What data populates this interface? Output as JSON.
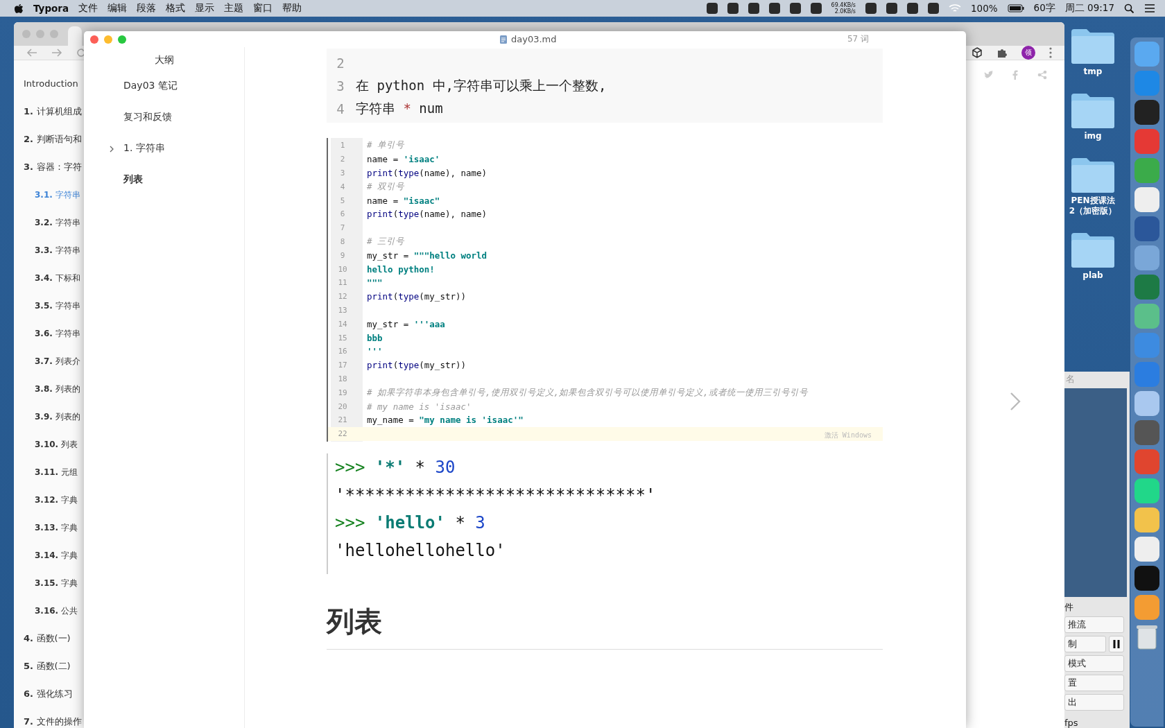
{
  "menubar": {
    "app": "Typora",
    "menus": [
      "文件",
      "编辑",
      "段落",
      "格式",
      "显示",
      "主题",
      "窗口",
      "帮助"
    ],
    "net_up": "69.4KB/s",
    "net_down": "2.0KB/s",
    "battery": "100%",
    "word_count": "60字",
    "clock": "周二 09:17"
  },
  "browser": {
    "avatar": "领",
    "toc": [
      {
        "title": "Introduction",
        "selected": false
      },
      {
        "number": "1.",
        "title": "计算机组成",
        "selected": false
      },
      {
        "number": "2.",
        "title": "判断语句和",
        "selected": false
      },
      {
        "number": "3.",
        "title": "容器：字符",
        "selected": false,
        "children": [
          {
            "number": "3.1.",
            "title": "字符串",
            "selected": true
          },
          {
            "number": "3.2.",
            "title": "字符串",
            "selected": false
          },
          {
            "number": "3.3.",
            "title": "字符串",
            "selected": false
          },
          {
            "number": "3.4.",
            "title": "下标和",
            "selected": false
          },
          {
            "number": "3.5.",
            "title": "字符串",
            "selected": false
          },
          {
            "number": "3.6.",
            "title": "字符串",
            "selected": false
          },
          {
            "number": "3.7.",
            "title": "列表介",
            "selected": false
          },
          {
            "number": "3.8.",
            "title": "列表的",
            "selected": false
          },
          {
            "number": "3.9.",
            "title": "列表的",
            "selected": false
          },
          {
            "number": "3.10.",
            "title": "列表",
            "selected": false
          },
          {
            "number": "3.11.",
            "title": "元组",
            "selected": false
          },
          {
            "number": "3.12.",
            "title": "字典",
            "selected": false
          },
          {
            "number": "3.13.",
            "title": "字典",
            "selected": false
          },
          {
            "number": "3.14.",
            "title": "字典",
            "selected": false
          },
          {
            "number": "3.15.",
            "title": "字典",
            "selected": false
          },
          {
            "number": "3.16.",
            "title": "公共",
            "selected": false
          }
        ]
      },
      {
        "number": "4.",
        "title": "函数(一)",
        "selected": false
      },
      {
        "number": "5.",
        "title": "函数(二)",
        "selected": false
      },
      {
        "number": "6.",
        "title": "强化练习",
        "selected": false
      },
      {
        "number": "7.",
        "title": "文件的操作",
        "selected": false
      }
    ]
  },
  "typora": {
    "file_name": "day03.md",
    "word_count": "57 词",
    "outline": {
      "title": "大纲",
      "items": [
        {
          "label": "Day03 笔记",
          "kind": "normal"
        },
        {
          "label": "复习和反馈",
          "kind": "normal"
        },
        {
          "label": "1. 字符串",
          "kind": "normal",
          "expanded": false
        },
        {
          "label": "列表",
          "kind": "strong"
        }
      ]
    },
    "code_block": [
      {
        "n": "2"
      },
      {
        "n": "3",
        "tokens": [
          {
            "kind": "plain",
            "text": "在 python 中,字符串可以乘上一个整数,"
          }
        ]
      },
      {
        "n": "4",
        "tokens": [
          {
            "kind": "plain",
            "text": "字符串 "
          },
          {
            "kind": "operator",
            "text": "*"
          },
          {
            "kind": "plain",
            "text": " num"
          }
        ]
      }
    ],
    "editor_screenshot": {
      "watermark_text": "激活 Windows",
      "lines": [
        {
          "n": "1",
          "tokens": [
            {
              "kind": "comment",
              "text": "# 单引号"
            }
          ]
        },
        {
          "n": "2",
          "tokens": [
            {
              "kind": "plain",
              "text": "name = "
            },
            {
              "kind": "string",
              "text": "'isaac'"
            }
          ]
        },
        {
          "n": "3",
          "tokens": [
            {
              "kind": "keyword",
              "text": "print"
            },
            {
              "kind": "plain",
              "text": "("
            },
            {
              "kind": "keyword",
              "text": "type"
            },
            {
              "kind": "plain",
              "text": "(name), name)"
            }
          ]
        },
        {
          "n": "4",
          "tokens": [
            {
              "kind": "comment",
              "text": "# 双引号"
            }
          ]
        },
        {
          "n": "5",
          "tokens": [
            {
              "kind": "plain",
              "text": "name = "
            },
            {
              "kind": "string",
              "text": "\"isaac\""
            }
          ]
        },
        {
          "n": "6",
          "tokens": [
            {
              "kind": "keyword",
              "text": "print"
            },
            {
              "kind": "plain",
              "text": "("
            },
            {
              "kind": "keyword",
              "text": "type"
            },
            {
              "kind": "plain",
              "text": "(name), name)"
            }
          ]
        },
        {
          "n": "7"
        },
        {
          "n": "8",
          "tokens": [
            {
              "kind": "comment",
              "text": "# 三引号"
            }
          ]
        },
        {
          "n": "9",
          "tokens": [
            {
              "kind": "plain",
              "text": "my_str = "
            },
            {
              "kind": "string",
              "text": "\"\"\"hello world"
            }
          ]
        },
        {
          "n": "10",
          "tokens": [
            {
              "kind": "string",
              "text": "hello python!"
            }
          ]
        },
        {
          "n": "11",
          "tokens": [
            {
              "kind": "string",
              "text": "\"\"\""
            }
          ]
        },
        {
          "n": "12",
          "tokens": [
            {
              "kind": "keyword",
              "text": "print"
            },
            {
              "kind": "plain",
              "text": "("
            },
            {
              "kind": "keyword",
              "text": "type"
            },
            {
              "kind": "plain",
              "text": "(my_str))"
            }
          ]
        },
        {
          "n": "13"
        },
        {
          "n": "14",
          "tokens": [
            {
              "kind": "plain",
              "text": "my_str = "
            },
            {
              "kind": "string",
              "text": "'''aaa"
            }
          ]
        },
        {
          "n": "15",
          "tokens": [
            {
              "kind": "string",
              "text": "bbb"
            }
          ]
        },
        {
          "n": "16",
          "tokens": [
            {
              "kind": "string",
              "text": "'''"
            }
          ]
        },
        {
          "n": "17",
          "tokens": [
            {
              "kind": "keyword",
              "text": "print"
            },
            {
              "kind": "plain",
              "text": "("
            },
            {
              "kind": "keyword",
              "text": "type"
            },
            {
              "kind": "plain",
              "text": "(my_str))"
            }
          ]
        },
        {
          "n": "18"
        },
        {
          "n": "19",
          "tokens": [
            {
              "kind": "comment",
              "text": "# 如果字符串本身包含单引号,使用双引号定义,如果包含双引号可以使用单引号定义,或者统一使用三引号引号"
            }
          ]
        },
        {
          "n": "20",
          "tokens": [
            {
              "kind": "comment",
              "text": "# my name is 'isaac'"
            }
          ]
        },
        {
          "n": "21",
          "tokens": [
            {
              "kind": "plain",
              "text": "my_name = "
            },
            {
              "kind": "string",
              "text": "\"my name is 'isaac'\""
            }
          ]
        },
        {
          "n": "22",
          "current": true
        }
      ]
    },
    "repl_screenshot": [
      [
        {
          "kind": "prompt",
          "text": ">>> "
        },
        {
          "kind": "string",
          "text": "'*'"
        },
        {
          "kind": "plain",
          "text": " * "
        },
        {
          "kind": "number",
          "text": "30"
        }
      ],
      [
        {
          "kind": "plain",
          "text": "'******************************'"
        }
      ],
      [
        {
          "kind": "prompt",
          "text": ">>> "
        },
        {
          "kind": "string",
          "text": "'hello'"
        },
        {
          "kind": "plain",
          "text": " * "
        },
        {
          "kind": "number",
          "text": "3"
        }
      ],
      [
        {
          "kind": "plain",
          "text": "'hellohellohello'"
        }
      ]
    ],
    "heading": "列表"
  },
  "desktop_folders": [
    {
      "label": "tmp"
    },
    {
      "label": "img"
    },
    {
      "label": "PEN授课法\n2（加密版）"
    },
    {
      "label": "plab"
    }
  ],
  "obs": {
    "title": "名",
    "section": "件",
    "buttons": [
      {
        "label": "推流"
      },
      {
        "label": "制",
        "pause": true
      },
      {
        "label": "模式"
      },
      {
        "label": "置"
      },
      {
        "label": "出"
      }
    ],
    "status": "fps"
  }
}
